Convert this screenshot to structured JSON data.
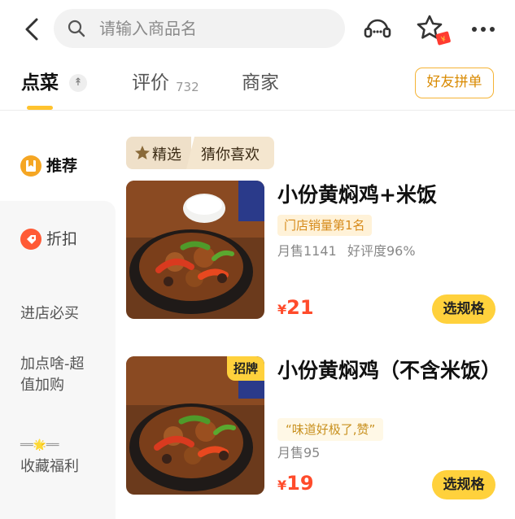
{
  "search": {
    "placeholder": "请输入商品名"
  },
  "tabs": {
    "order": "点菜",
    "order_icon": "↟",
    "reviews": "评价",
    "reviews_count": "732",
    "merchant": "商家",
    "group_buy": "好友拼单"
  },
  "sidebar": {
    "items": [
      {
        "label": "推荐",
        "icon": "bookmark-icon",
        "color": "#f5a623",
        "active": true
      },
      {
        "label": "折扣",
        "icon": "discount-tag-icon",
        "color": "#ff5a36"
      },
      {
        "label": "进店必买"
      },
      {
        "label": "加点啥-超值加购"
      },
      {
        "label": "收藏福利",
        "prefix": "══🌟══"
      }
    ]
  },
  "section": {
    "tag_left": "精选",
    "tag_right": "猜你喜欢"
  },
  "dishes": [
    {
      "name": "小份黄焖鸡+米饭",
      "badge": "门店销量第1名",
      "monthly_sales": "月售1141",
      "rating": "好评度96%",
      "currency": "¥",
      "price": "21",
      "button": "选规格"
    },
    {
      "name": "小份黄焖鸡（不含米饭）",
      "signature": "招牌",
      "quote": "“味道好极了,赞”",
      "monthly_sales": "月售95",
      "currency": "¥",
      "price": "19",
      "button": "选规格"
    }
  ],
  "colors": {
    "accent": "#ffd13c",
    "price": "#ff4b2b",
    "brand_border": "#f5b335"
  }
}
